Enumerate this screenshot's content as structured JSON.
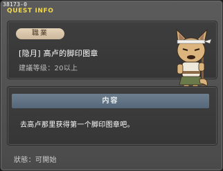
{
  "window": {
    "quest_id": "38173-0",
    "title": "QUEST INFO"
  },
  "quest": {
    "job_label": "職業",
    "name": "[隐月] 高卢的脚印图章",
    "level_requirement": "建議等级：20以上"
  },
  "content": {
    "header": "内容",
    "text": "去高卢那里获得第一个脚印图章吧。"
  },
  "status": {
    "text": "狀態：可開始"
  },
  "npc": {
    "icon": "npc-fox-warrior-icon"
  },
  "colors": {
    "title": "#f2d84a",
    "header_bar": "#5f7284",
    "job_badge": "#dcc8ab"
  }
}
